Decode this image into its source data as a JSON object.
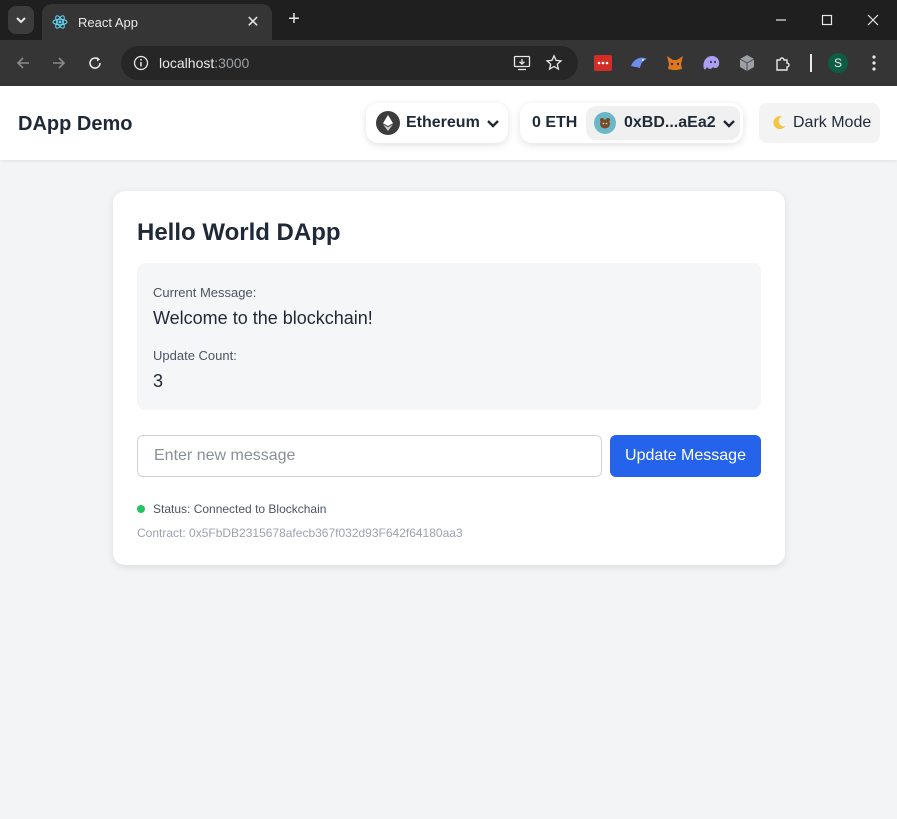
{
  "browser": {
    "tab_title": "React App",
    "url_host": "localhost",
    "url_port": ":3000",
    "profile_initial": "S",
    "icons": {
      "tab_list": "chevron-down-icon",
      "tab_favicon": "react-icon",
      "tab_close": "close-icon",
      "new_tab": "plus-icon",
      "minimize": "minimize-icon",
      "maximize": "maximize-icon",
      "close_window": "close-icon",
      "back": "back-arrow-icon",
      "forward": "forward-arrow-icon",
      "reload": "reload-icon",
      "site_info": "info-icon",
      "install": "install-icon",
      "bookmark": "star-icon",
      "extensions": [
        "lastpass-icon",
        "bird-icon",
        "metamask-icon",
        "ghost-icon",
        "cube-icon",
        "puzzle-icon"
      ],
      "menu": "kebab-menu-icon"
    }
  },
  "header": {
    "brand": "DApp Demo",
    "chain": "Ethereum",
    "balance": "0 ETH",
    "address": "0xBD...aEa2",
    "dark_mode_label": "Dark Mode",
    "dark_mode_icon": "moon-icon"
  },
  "card": {
    "title": "Hello World DApp",
    "current_message_label": "Current Message:",
    "current_message": "Welcome to the blockchain!",
    "update_count_label": "Update Count:",
    "update_count": "3",
    "input_placeholder": "Enter new message",
    "input_value": "",
    "update_button": "Update Message",
    "status": "Status: Connected to Blockchain",
    "contract": "Contract: 0x5FbDB2315678afecb367f032d93F642f64180aa3"
  },
  "colors": {
    "primary": "#2563eb",
    "status_ok": "#22c55e",
    "page_bg": "#f3f4f6"
  }
}
